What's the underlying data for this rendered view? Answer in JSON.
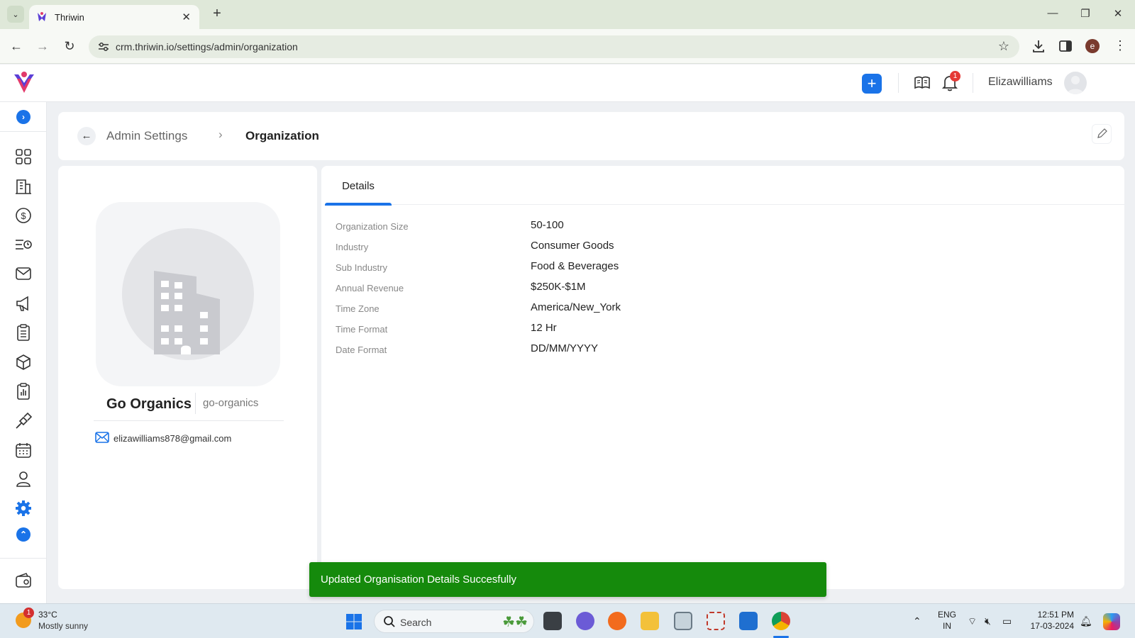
{
  "browser": {
    "tab_title": "Thriwin",
    "url": "crm.thriwin.io/settings/admin/organization",
    "profile_initial": "e"
  },
  "header": {
    "username": "Elizawilliams",
    "notification_count": "1"
  },
  "breadcrumb": {
    "parent": "Admin Settings",
    "current": "Organization"
  },
  "organization": {
    "name": "Go Organics",
    "slug": "go-organics",
    "email": "elizawilliams878@gmail.com"
  },
  "details": {
    "tab_label": "Details",
    "rows": [
      {
        "label": "Organization Size",
        "value": "50-100"
      },
      {
        "label": "Industry",
        "value": "Consumer Goods"
      },
      {
        "label": "Sub Industry",
        "value": "Food & Beverages"
      },
      {
        "label": "Annual Revenue",
        "value": "$250K-$1M"
      },
      {
        "label": "Time Zone",
        "value": "America/New_York"
      },
      {
        "label": "Time Format",
        "value": "12 Hr"
      },
      {
        "label": "Date Format",
        "value": "DD/MM/YYYY"
      }
    ]
  },
  "toast": {
    "message": "Updated Organisation Details Succesfully"
  },
  "taskbar": {
    "weather_temp": "33°C",
    "weather_desc": "Mostly sunny",
    "weather_badge": "1",
    "search_label": "Search",
    "lang_top": "ENG",
    "lang_bottom": "IN",
    "time": "12:51 PM",
    "date": "17-03-2024"
  },
  "colors": {
    "accent": "#1a73e8",
    "toast": "#158a0c",
    "badge": "#e53935"
  }
}
